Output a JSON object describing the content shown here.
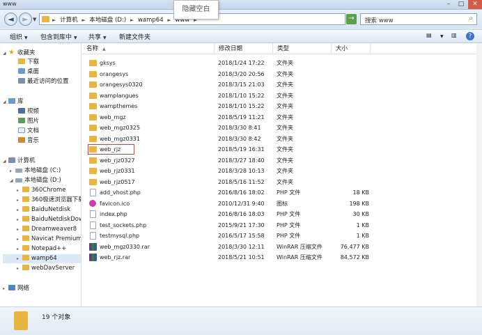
{
  "window": {
    "title": "www",
    "controls": {
      "minimize": "–",
      "maximize": "□",
      "close": "✕"
    }
  },
  "tooltip": "隐藏空白",
  "address": {
    "back_glyph": "◄",
    "forward_glyph": "►",
    "history_glyph": "▼",
    "crumbs": [
      "计算机",
      "本地磁盘 (D:)",
      "wamp64",
      "www"
    ],
    "separator": "►",
    "dropdown_glyph": "▼",
    "refresh_glyph": "→",
    "search_placeholder": "搜索 www",
    "search_glyph": "⌕"
  },
  "toolbar": {
    "organize": "组织",
    "library": "包含到库中",
    "share": "共享",
    "new_folder": "新建文件夹",
    "caret": "▼",
    "view_glyph": "▤",
    "view_caret": "▼",
    "pane_glyph": "▥",
    "help_glyph": "?"
  },
  "nav": {
    "favorites": "收藏夹",
    "downloads": "下载",
    "desktop": "桌面",
    "recent": "最近访问的位置",
    "libraries": "库",
    "videos": "视频",
    "pictures": "图片",
    "documents": "文档",
    "music": "音乐",
    "computer": "计算机",
    "drive_c": "本地磁盘 (C:)",
    "drive_d": "本地磁盘 (D:)",
    "folders": [
      "360Chrome",
      "360极速浏览器下载",
      "BaiduNetdisk",
      "BaiduNetdiskDownload",
      "Dreamweaver8",
      "Navicat Premium",
      "Notepad++",
      "wamp64",
      "webDavServer"
    ],
    "network": "网络",
    "expand_glyph": "▸",
    "collapse_glyph": "◢",
    "star_glyph": "★"
  },
  "columns": {
    "name": "名称",
    "date": "修改日期",
    "type": "类型",
    "size": "大小",
    "sort_glyph": "▲"
  },
  "files": [
    {
      "name": "gksys",
      "date": "2018/1/24 17:22",
      "type": "文件夹",
      "size": "",
      "kind": "folder"
    },
    {
      "name": "orangesys",
      "date": "2018/3/20 20:56",
      "type": "文件夹",
      "size": "",
      "kind": "folder"
    },
    {
      "name": "orangesys0320",
      "date": "2018/3/15 21:03",
      "type": "文件夹",
      "size": "",
      "kind": "folder"
    },
    {
      "name": "wamplangues",
      "date": "2018/1/10 15:22",
      "type": "文件夹",
      "size": "",
      "kind": "folder"
    },
    {
      "name": "wampthemes",
      "date": "2018/1/10 15:22",
      "type": "文件夹",
      "size": "",
      "kind": "folder"
    },
    {
      "name": "web_mgz",
      "date": "2018/5/19 11:21",
      "type": "文件夹",
      "size": "",
      "kind": "folder"
    },
    {
      "name": "web_mgz0325",
      "date": "2018/3/30 8:41",
      "type": "文件夹",
      "size": "",
      "kind": "folder"
    },
    {
      "name": "web_mgz0331",
      "date": "2018/3/30 8:42",
      "type": "文件夹",
      "size": "",
      "kind": "folder"
    },
    {
      "name": "web_rjz",
      "date": "2018/5/19 16:31",
      "type": "文件夹",
      "size": "",
      "kind": "folder",
      "highlighted": true
    },
    {
      "name": "web_rjz0327",
      "date": "2018/3/27 18:40",
      "type": "文件夹",
      "size": "",
      "kind": "folder"
    },
    {
      "name": "web_rjz0331",
      "date": "2018/3/28 10:13",
      "type": "文件夹",
      "size": "",
      "kind": "folder"
    },
    {
      "name": "web_rjz0517",
      "date": "2018/5/16 11:52",
      "type": "文件夹",
      "size": "",
      "kind": "folder"
    },
    {
      "name": "add_vhost.php",
      "date": "2016/8/16 18:02",
      "type": "PHP 文件",
      "size": "18 KB",
      "kind": "php"
    },
    {
      "name": "favicon.ico",
      "date": "2010/12/31 9:40",
      "type": "图标",
      "size": "198 KB",
      "kind": "ico"
    },
    {
      "name": "index.php",
      "date": "2016/8/16 18:03",
      "type": "PHP 文件",
      "size": "30 KB",
      "kind": "php"
    },
    {
      "name": "test_sockets.php",
      "date": "2015/9/21 17:30",
      "type": "PHP 文件",
      "size": "1 KB",
      "kind": "php"
    },
    {
      "name": "testmysql.php",
      "date": "2016/5/17 15:58",
      "type": "PHP 文件",
      "size": "1 KB",
      "kind": "php"
    },
    {
      "name": "web_mgz0330.rar",
      "date": "2018/3/30 12:11",
      "type": "WinRAR 压缩文件",
      "size": "76,477 KB",
      "kind": "rar"
    },
    {
      "name": "web_rjz.rar",
      "date": "2018/5/21 10:51",
      "type": "WinRAR 压缩文件",
      "size": "84,572 KB",
      "kind": "rar"
    }
  ],
  "status": {
    "count_text": "19 个对象"
  }
}
